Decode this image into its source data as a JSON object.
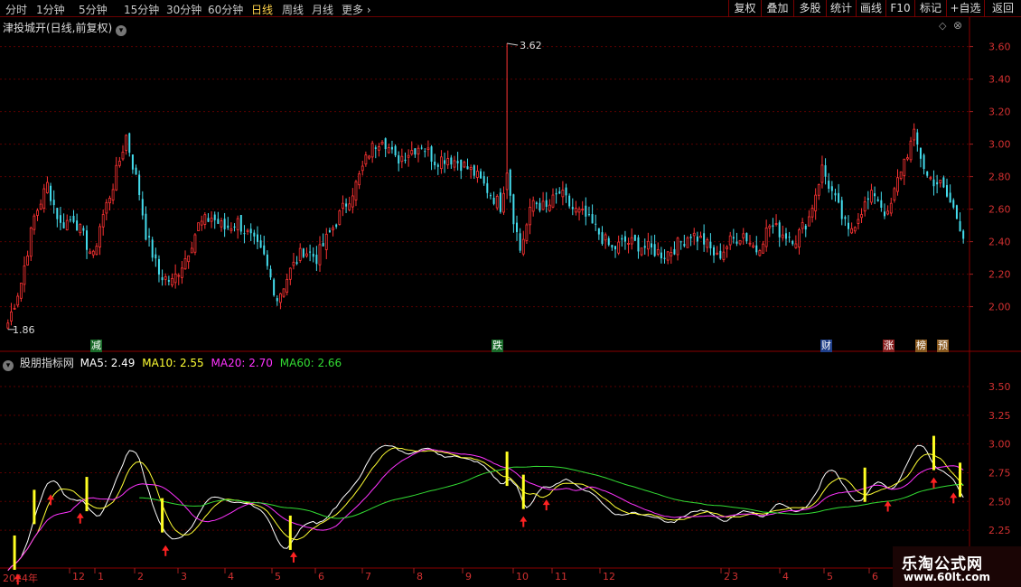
{
  "toolbar": {
    "periods": [
      "分时",
      "1分钟",
      "5分钟",
      "15分钟",
      "30分钟",
      "60分钟",
      "日线",
      "周线",
      "月线",
      "更多"
    ],
    "active_period": "日线",
    "right_buttons": [
      "复权",
      "叠加",
      "多股",
      "统计",
      "画线",
      "F10",
      "标记",
      "+自选",
      "返回"
    ]
  },
  "price_panel": {
    "title": "津投城开(日线,前复权)",
    "max_label": "3.62",
    "min_label": "1.86",
    "y_ticks": [
      "3.60",
      "3.40",
      "3.20",
      "3.00",
      "2.80",
      "2.60",
      "2.40",
      "2.20",
      "2.00"
    ],
    "flags": [
      {
        "text": "减",
        "color": "#1a6b2a"
      },
      {
        "text": "跌",
        "color": "#1a6b2a"
      },
      {
        "text": "财",
        "color": "#1f3f8a"
      },
      {
        "text": "涨",
        "color": "#8a1f1f"
      },
      {
        "text": "榜",
        "color": "#8a5a1f"
      },
      {
        "text": "预",
        "color": "#8a5a1f"
      }
    ]
  },
  "indicator_panel": {
    "name": "股朋指标网",
    "ma_labels": [
      {
        "text": "MA5: 2.49",
        "color": "#ffffff"
      },
      {
        "text": "MA10: 2.55",
        "color": "#ffff33"
      },
      {
        "text": "MA20: 2.70",
        "color": "#ff33ff"
      },
      {
        "text": "MA60: 2.66",
        "color": "#33dd33"
      }
    ],
    "y_ticks": [
      "3.50",
      "3.25",
      "3.00",
      "2.75",
      "2.50",
      "2.25"
    ]
  },
  "x_axis": [
    "2024年",
    "12",
    "1",
    "2",
    "3",
    "4",
    "5",
    "6",
    "7",
    "8",
    "9",
    "10",
    "11",
    "12",
    "2",
    "3",
    "4",
    "5",
    "6"
  ],
  "logo": {
    "line1": "乐淘公式网",
    "line2": "www.60lt.com"
  },
  "chart_data": {
    "type": "candlestick",
    "price_ylim": [
      1.82,
      3.72
    ],
    "indicator_ylim": [
      2.07,
      3.72
    ],
    "ma_series": [
      {
        "name": "MA5",
        "color": "#ffffff",
        "last": 2.49
      },
      {
        "name": "MA10",
        "color": "#ffff33",
        "last": 2.55
      },
      {
        "name": "MA20",
        "color": "#ff33ff",
        "last": 2.7
      },
      {
        "name": "MA60",
        "color": "#33dd33",
        "last": 2.66
      }
    ],
    "close_keypoints": [
      [
        0,
        1.9
      ],
      [
        4,
        2.15
      ],
      [
        8,
        2.55
      ],
      [
        12,
        2.75
      ],
      [
        16,
        2.5
      ],
      [
        20,
        2.55
      ],
      [
        26,
        2.3
      ],
      [
        28,
        2.5
      ],
      [
        32,
        2.75
      ],
      [
        36,
        3.05
      ],
      [
        40,
        2.7
      ],
      [
        42,
        2.45
      ],
      [
        46,
        2.2
      ],
      [
        50,
        2.15
      ],
      [
        54,
        2.3
      ],
      [
        58,
        2.5
      ],
      [
        62,
        2.55
      ],
      [
        66,
        2.48
      ],
      [
        70,
        2.52
      ],
      [
        74,
        2.42
      ],
      [
        78,
        2.3
      ],
      [
        82,
        2.05
      ],
      [
        86,
        2.22
      ],
      [
        90,
        2.35
      ],
      [
        94,
        2.3
      ],
      [
        98,
        2.45
      ],
      [
        102,
        2.6
      ],
      [
        106,
        2.75
      ],
      [
        110,
        2.95
      ],
      [
        114,
        3.05
      ],
      [
        118,
        2.9
      ],
      [
        122,
        2.95
      ],
      [
        126,
        3.0
      ],
      [
        130,
        2.9
      ],
      [
        134,
        2.92
      ],
      [
        138,
        2.88
      ],
      [
        142,
        2.82
      ],
      [
        146,
        2.72
      ],
      [
        150,
        2.62
      ],
      [
        152,
        2.85
      ],
      [
        154,
        2.55
      ],
      [
        156,
        2.35
      ],
      [
        160,
        2.65
      ],
      [
        164,
        2.6
      ],
      [
        168,
        2.7
      ],
      [
        172,
        2.6
      ],
      [
        176,
        2.55
      ],
      [
        180,
        2.45
      ],
      [
        184,
        2.35
      ],
      [
        188,
        2.4
      ],
      [
        192,
        2.38
      ],
      [
        196,
        2.35
      ],
      [
        200,
        2.32
      ],
      [
        204,
        2.38
      ],
      [
        208,
        2.45
      ],
      [
        212,
        2.4
      ],
      [
        216,
        2.3
      ],
      [
        220,
        2.4
      ],
      [
        224,
        2.45
      ],
      [
        228,
        2.35
      ],
      [
        232,
        2.5
      ],
      [
        236,
        2.45
      ],
      [
        240,
        2.42
      ],
      [
        244,
        2.55
      ],
      [
        248,
        2.85
      ],
      [
        252,
        2.65
      ],
      [
        256,
        2.45
      ],
      [
        260,
        2.6
      ],
      [
        264,
        2.7
      ],
      [
        268,
        2.55
      ],
      [
        272,
        2.85
      ],
      [
        276,
        3.05
      ],
      [
        280,
        2.8
      ],
      [
        284,
        2.75
      ],
      [
        288,
        2.6
      ],
      [
        291,
        2.45
      ]
    ],
    "signal_arrows_x_index": [
      3,
      13,
      22,
      48,
      87,
      157,
      164,
      268,
      282,
      288
    ],
    "yellow_bar_x_index": [
      2,
      8,
      24,
      47,
      86,
      152,
      157,
      261,
      282,
      290
    ]
  }
}
